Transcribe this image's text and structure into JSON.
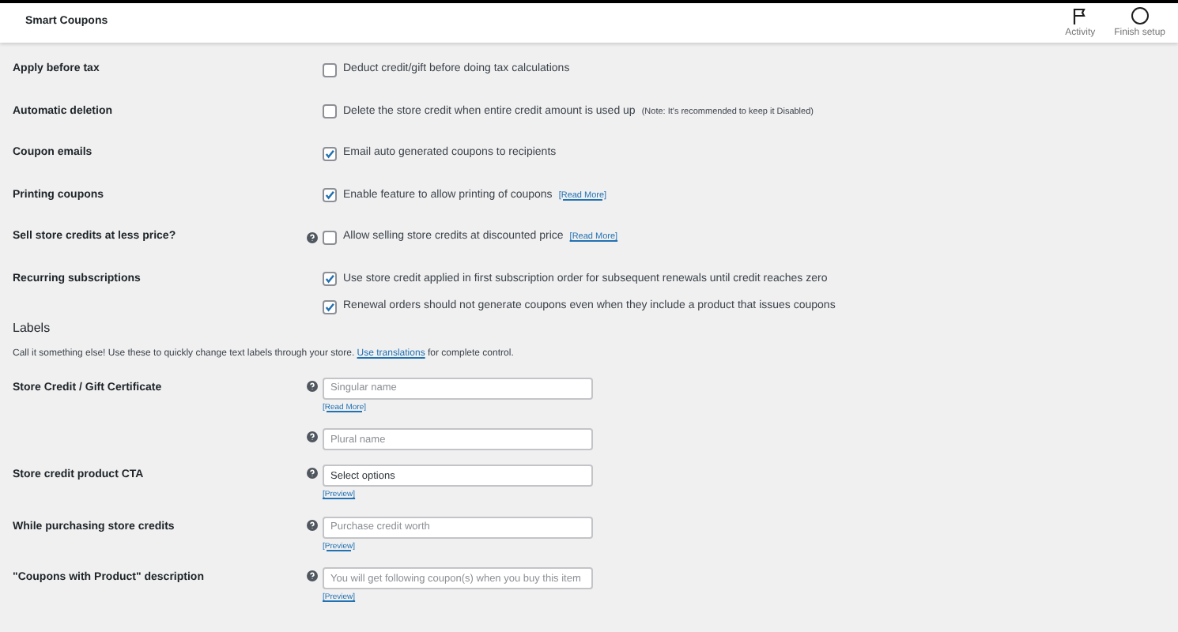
{
  "header": {
    "title": "Smart Coupons",
    "actions": [
      {
        "kind": "flag",
        "label": "Activity"
      },
      {
        "kind": "circle",
        "label": "Finish setup"
      }
    ]
  },
  "settings": [
    {
      "label": "Apply before tax",
      "help": false,
      "options": [
        {
          "text": "Deduct credit/gift before doing tax calculations",
          "checked": false
        }
      ]
    },
    {
      "label": "Automatic deletion",
      "help": false,
      "options": [
        {
          "text": "Delete the store credit when entire credit amount is used up",
          "note": "(Note: It's recommended to keep it Disabled)",
          "checked": false
        }
      ]
    },
    {
      "label": "Coupon emails",
      "help": false,
      "options": [
        {
          "text": "Email auto generated coupons to recipients",
          "checked": true
        }
      ]
    },
    {
      "label": "Printing coupons",
      "help": false,
      "options": [
        {
          "text": "Enable feature to allow printing of coupons",
          "link": "[Read More]",
          "checked": true
        }
      ]
    },
    {
      "label": "Sell store credits at less price?",
      "help": true,
      "options": [
        {
          "text": "Allow selling store credits at discounted price",
          "link": "[Read More]",
          "checked": false
        }
      ]
    },
    {
      "label": "Recurring subscriptions",
      "help": false,
      "options": [
        {
          "text": "Use store credit applied in first subscription order for subsequent renewals until credit reaches zero",
          "checked": true
        },
        {
          "text": "Renewal orders should not generate coupons even when they include a product that issues coupons",
          "checked": true
        }
      ]
    }
  ],
  "labels_section": {
    "title": "Labels",
    "description": "Call it something else! Use these to quickly change text labels through your store.",
    "description_link": "Use translations",
    "description_end": "for complete control.",
    "fields": [
      {
        "label": "Store Credit / Gift Certificate",
        "help": true,
        "placeholder": "Singular name",
        "link": "[Read More]"
      },
      {
        "help": true,
        "placeholder": "Plural name"
      },
      {
        "label": "Store credit product CTA",
        "help": true,
        "value": "Select options",
        "link": "[Preview]"
      },
      {
        "label": "While purchasing store credits",
        "help": true,
        "placeholder": "Purchase credit worth",
        "link": "[Preview]"
      },
      {
        "label": "\"Coupons with Product\" description",
        "help": true,
        "placeholder": "You will get following coupon(s) when you buy this item",
        "link": "[Preview]"
      }
    ]
  }
}
